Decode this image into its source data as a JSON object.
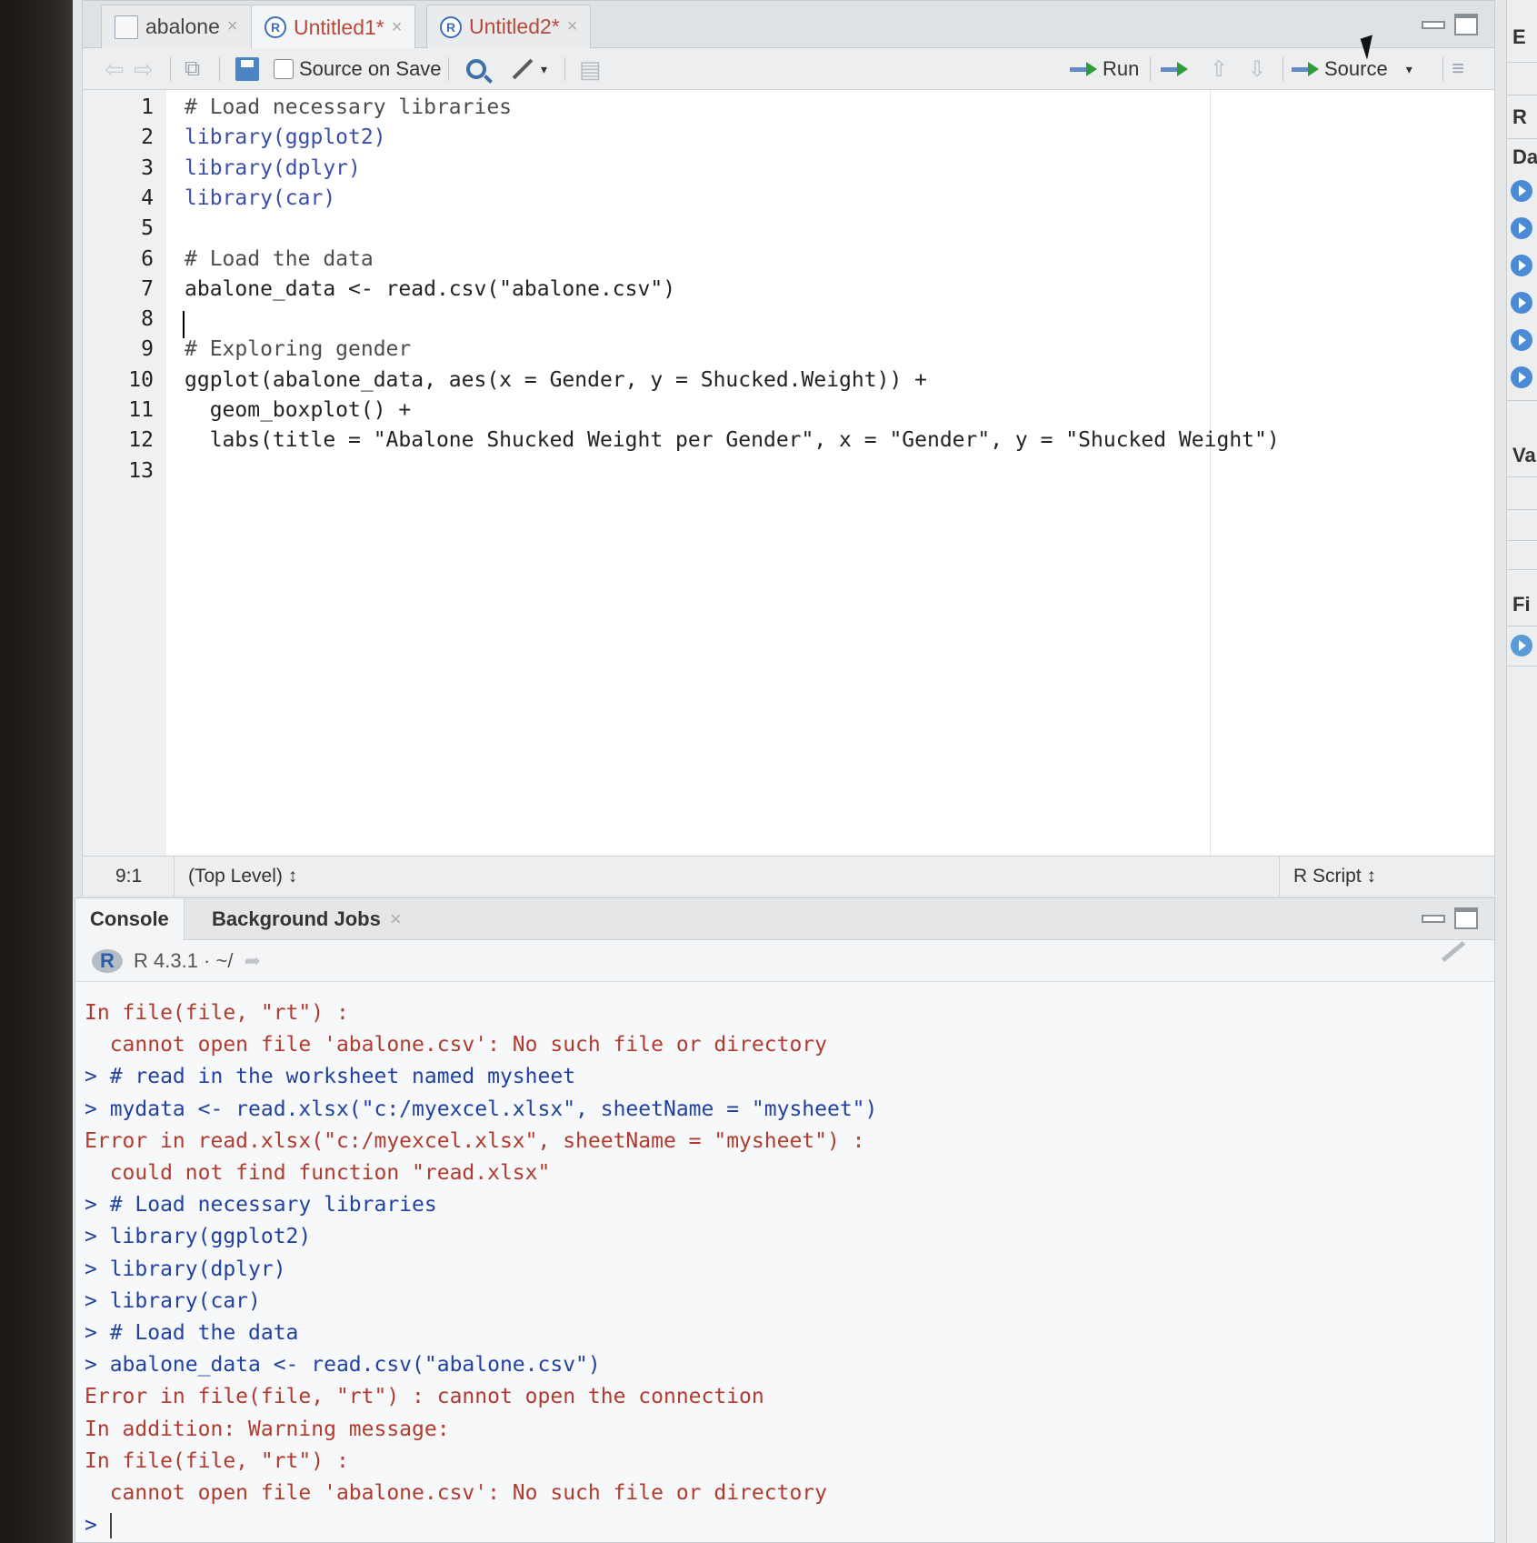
{
  "source": {
    "tabs": [
      {
        "label": "abalone",
        "modified": false,
        "icon": "table-icon"
      },
      {
        "label": "Untitled1",
        "modified": true,
        "icon": "r-file-icon"
      },
      {
        "label": "Untitled2",
        "modified": true,
        "icon": "r-file-icon"
      }
    ],
    "modified_marker": "*",
    "toolbar": {
      "source_on_save": "Source on Save",
      "run": "Run",
      "source": "Source"
    },
    "line_numbers": [
      "1",
      "2",
      "3",
      "4",
      "5",
      "6",
      "7",
      "8",
      "9",
      "10",
      "11",
      "12",
      "13"
    ],
    "code_lines": [
      {
        "text": "# Load necessary libraries",
        "kind": "comment"
      },
      {
        "text": "library(ggplot2)",
        "kind": "lib"
      },
      {
        "text": "library(dplyr)",
        "kind": "lib"
      },
      {
        "text": "library(car)",
        "kind": "lib"
      },
      {
        "text": "",
        "kind": "code"
      },
      {
        "text": "# Load the data",
        "kind": "comment"
      },
      {
        "text": "abalone_data <- read.csv(\"abalone.csv\")",
        "kind": "code"
      },
      {
        "text": "",
        "kind": "code"
      },
      {
        "text": "# Exploring gender",
        "kind": "comment"
      },
      {
        "text": "ggplot(abalone_data, aes(x = Gender, y = Shucked.Weight)) +",
        "kind": "code"
      },
      {
        "text": "  geom_boxplot() +",
        "kind": "code"
      },
      {
        "text": "  labs(title = \"Abalone Shucked Weight per Gender\", x = \"Gender\", y = \"Shucked Weight\")",
        "kind": "code"
      },
      {
        "text": "",
        "kind": "code"
      }
    ],
    "status": {
      "position": "9:1",
      "scope": "(Top Level) ↕",
      "file_type": "R Script ↕"
    }
  },
  "console": {
    "tabs": [
      "Console",
      "Background Jobs"
    ],
    "r_version": "R 4.3.1 · ~/",
    "lines": [
      {
        "text": "In file(file, \"rt\") :",
        "kind": "out"
      },
      {
        "text": "  cannot open file 'abalone.csv': No such file or directory",
        "kind": "out"
      },
      {
        "text": "> # read in the worksheet named mysheet",
        "kind": "in"
      },
      {
        "text": "> mydata <- read.xlsx(\"c:/myexcel.xlsx\", sheetName = \"mysheet\")",
        "kind": "in"
      },
      {
        "text": "Error in read.xlsx(\"c:/myexcel.xlsx\", sheetName = \"mysheet\") :",
        "kind": "out"
      },
      {
        "text": "  could not find function \"read.xlsx\"",
        "kind": "out"
      },
      {
        "text": "> # Load necessary libraries",
        "kind": "in"
      },
      {
        "text": "> library(ggplot2)",
        "kind": "in"
      },
      {
        "text": "> library(dplyr)",
        "kind": "in"
      },
      {
        "text": "> library(car)",
        "kind": "in"
      },
      {
        "text": "> # Load the data",
        "kind": "in"
      },
      {
        "text": "> abalone_data <- read.csv(\"abalone.csv\")",
        "kind": "in"
      },
      {
        "text": "Error in file(file, \"rt\") : cannot open the connection",
        "kind": "out"
      },
      {
        "text": "In addition: Warning message:",
        "kind": "out"
      },
      {
        "text": "In file(file, \"rt\") :",
        "kind": "out"
      },
      {
        "text": "  cannot open file 'abalone.csv': No such file or directory",
        "kind": "out"
      }
    ],
    "prompt": ">"
  },
  "right_pane": {
    "letters": [
      "E",
      "R",
      "Da",
      "Va",
      "Fi"
    ]
  },
  "colors": {
    "comment": "#4d4d4d",
    "library_call": "#3b4fa8",
    "console_input": "#2142a0",
    "console_error": "#b03b2e",
    "modified_tab": "#b84a3b"
  }
}
